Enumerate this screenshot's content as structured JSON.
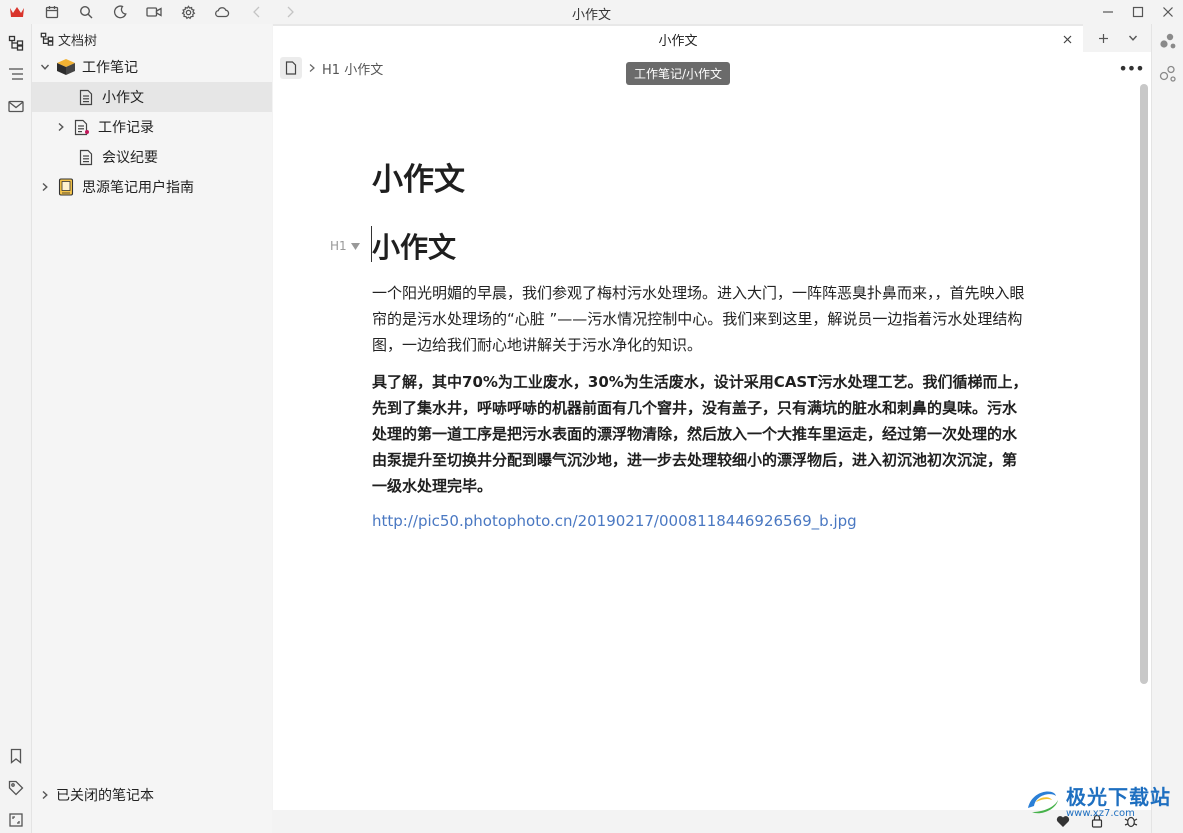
{
  "window": {
    "title": "小作文"
  },
  "tree": {
    "header": "文档树",
    "items": [
      {
        "label": "工作笔记",
        "kind": "notebook"
      },
      {
        "label": "小作文",
        "kind": "doc",
        "selected": true
      },
      {
        "label": "工作记录",
        "kind": "doc"
      },
      {
        "label": "会议纪要",
        "kind": "doc"
      },
      {
        "label": "思源笔记用户指南",
        "kind": "notebook"
      }
    ],
    "closed_notebooks": "已关闭的笔记本"
  },
  "editor": {
    "tab_title": "小作文",
    "breadcrumb_heading_tag": "H1",
    "breadcrumb_heading": "小作文",
    "tooltip": "工作笔记/小作文",
    "doc_title": "小作文",
    "h1_marker": "H1",
    "heading": "小作文",
    "paragraph1": "一个阳光明媚的早晨，我们参观了梅村污水处理场。进入大门，一阵阵恶臭扑鼻而来，，首先映入眼帘的是污水处理场的“心脏 ”——污水情况控制中心。我们来到这里，解说员一边指着污水处理结构图，一边给我们耐心地讲解关于污水净化的知识。",
    "paragraph2": "具了解，其中70%为工业废水，30%为生活废水，设计采用CAST污水处理工艺。我们循梯而上，先到了集水井，呼哧呼哧的机器前面有几个窨井，没有盖子，只有满坑的脏水和刺鼻的臭味。污水处理的第一道工序是把污水表面的漂浮物清除，然后放入一个大推车里运走，经过第一次处理的水由泵提升至切换井分配到曝气沉沙地，进一步去处理较细小的漂浮物后，进入初沉池初次沉淀，第一级水处理完毕。",
    "link": "http://pic50.photophoto.cn/20190217/0008118446926569_b.jpg"
  },
  "watermark": {
    "text": "极光下载站",
    "sub": "www.xz7.com"
  },
  "colors": {
    "link": "#4a78c2",
    "logo_red": "#d9342b",
    "tooltip_bg": "#6b6b6b",
    "selected_row": "#e6e6e6"
  }
}
